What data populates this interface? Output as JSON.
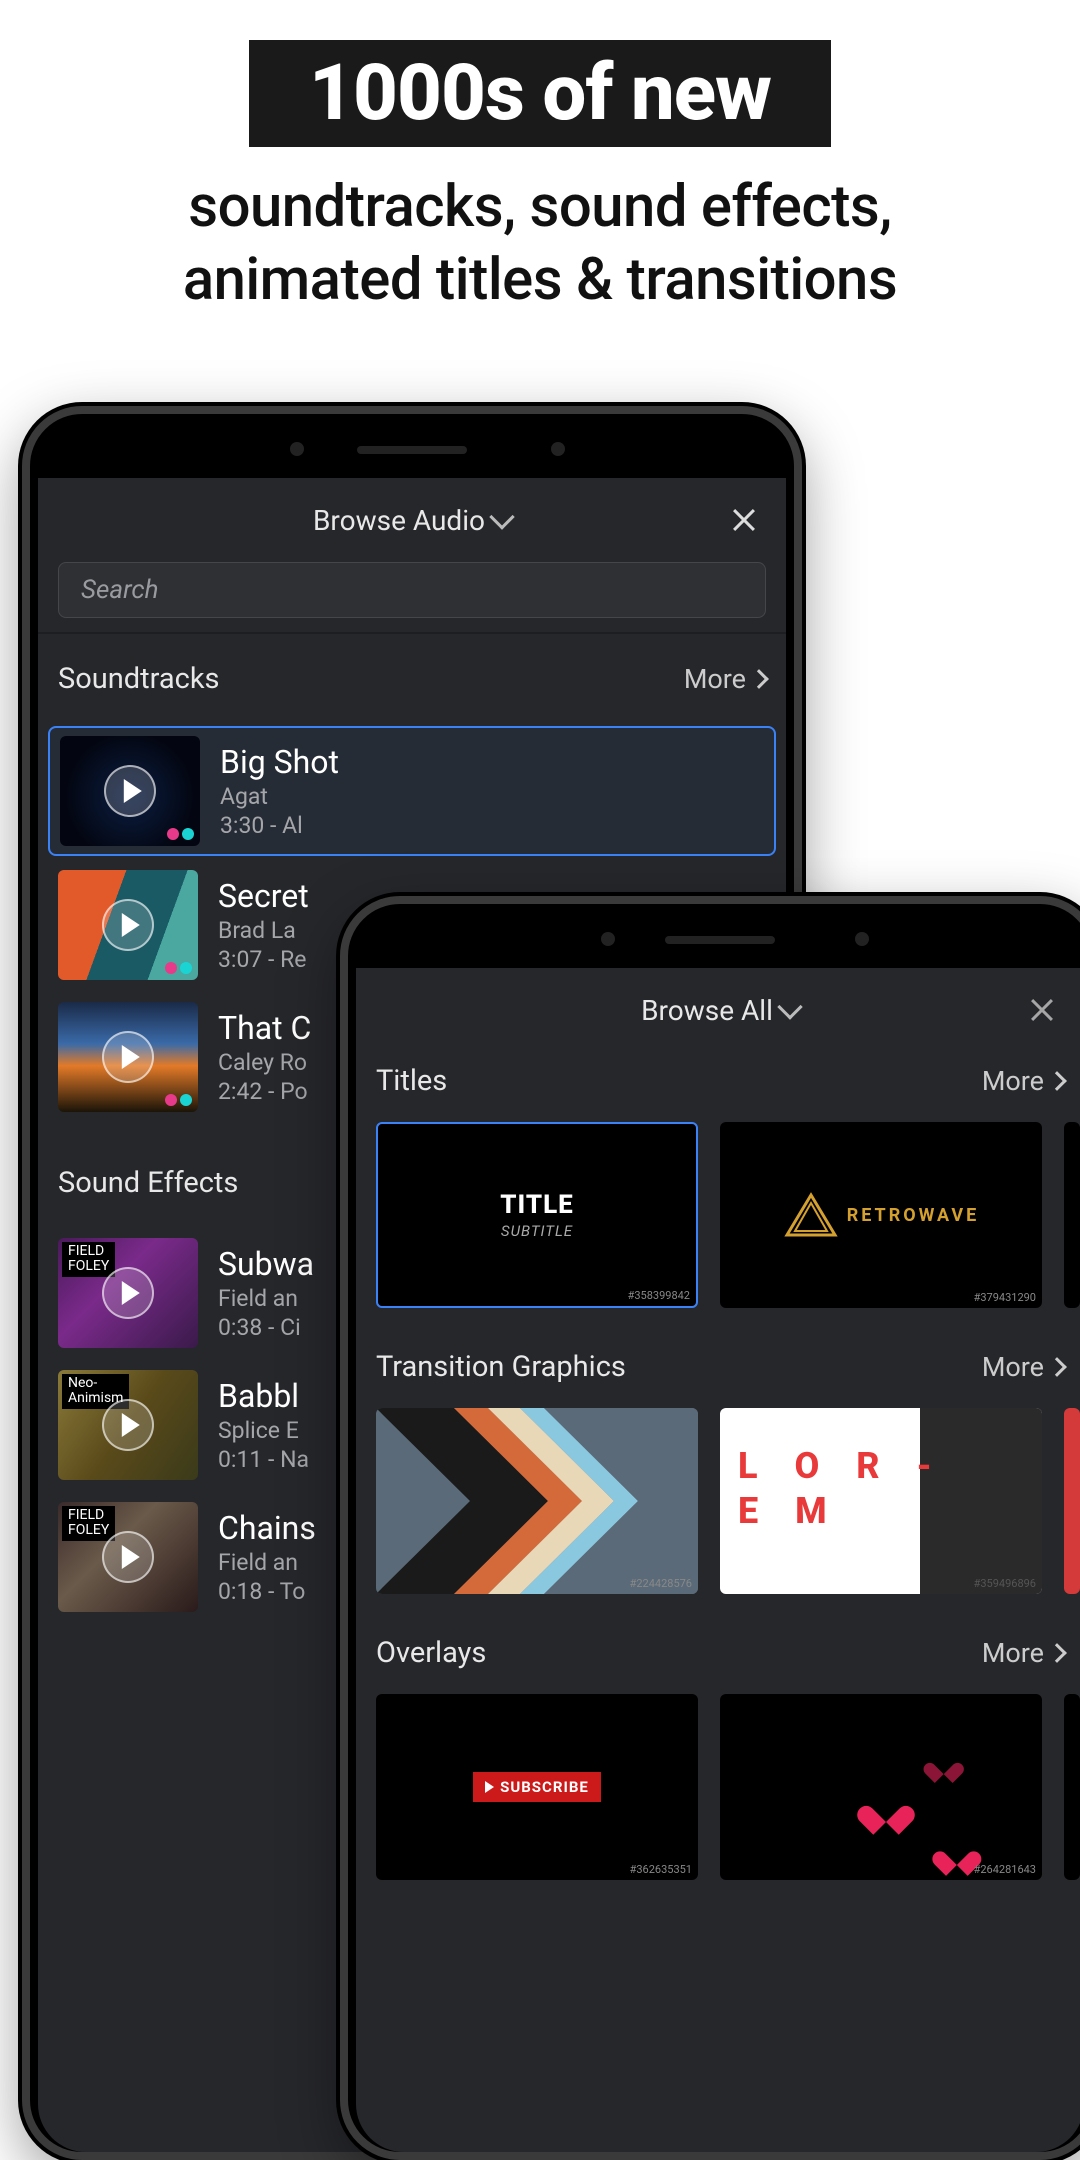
{
  "header": {
    "highlight": "1000s of new",
    "subtitle": "soundtracks, sound effects,\nanimated titles & transitions"
  },
  "phone1": {
    "browse_label": "Browse Audio",
    "search_placeholder": "Search",
    "sections": {
      "soundtracks": {
        "title": "Soundtracks",
        "more": "More",
        "tracks": [
          {
            "title": "Big Shot",
            "artist": "Agat",
            "info": "3:30 - Al"
          },
          {
            "title": "Secret",
            "artist": "Brad La",
            "info": "3:07 - Re"
          },
          {
            "title": "That C",
            "artist": "Caley Ro",
            "info": "2:42 - Po"
          }
        ]
      },
      "sound_effects": {
        "title": "Sound Effects",
        "tracks": [
          {
            "badge_top": "FIELD",
            "badge_bot": "FOLEY",
            "title": "Subwa",
            "artist": "Field an",
            "info": "0:38 - Ci"
          },
          {
            "badge_top": "Neo-",
            "badge_bot": "Animism",
            "title": "Babbl",
            "artist": "Splice E",
            "info": "0:11 - Na"
          },
          {
            "badge_top": "FIELD",
            "badge_bot": "FOLEY",
            "title": "Chains",
            "artist": "Field an",
            "info": "0:18 - To"
          }
        ]
      }
    }
  },
  "phone2": {
    "browse_label": "Browse All",
    "sections": {
      "titles": {
        "title": "Titles",
        "more": "More",
        "cards": [
          {
            "kind": "title_subtitle",
            "line1": "TITLE",
            "line2": "SUBTITLE",
            "asset_id": "#358399842"
          },
          {
            "kind": "retrowave",
            "text": "RETROWAVE",
            "asset_id": "#379431290"
          }
        ]
      },
      "transitions": {
        "title": "Transition Graphics",
        "more": "More",
        "cards": [
          {
            "asset_id": "#224428576"
          },
          {
            "line1": "L O R -",
            "line2": "E M",
            "asset_id": "#359496896"
          }
        ]
      },
      "overlays": {
        "title": "Overlays",
        "more": "More",
        "cards": [
          {
            "label": "SUBSCRIBE",
            "asset_id": "#362635351"
          },
          {
            "asset_id": "#264281643"
          }
        ]
      }
    }
  }
}
